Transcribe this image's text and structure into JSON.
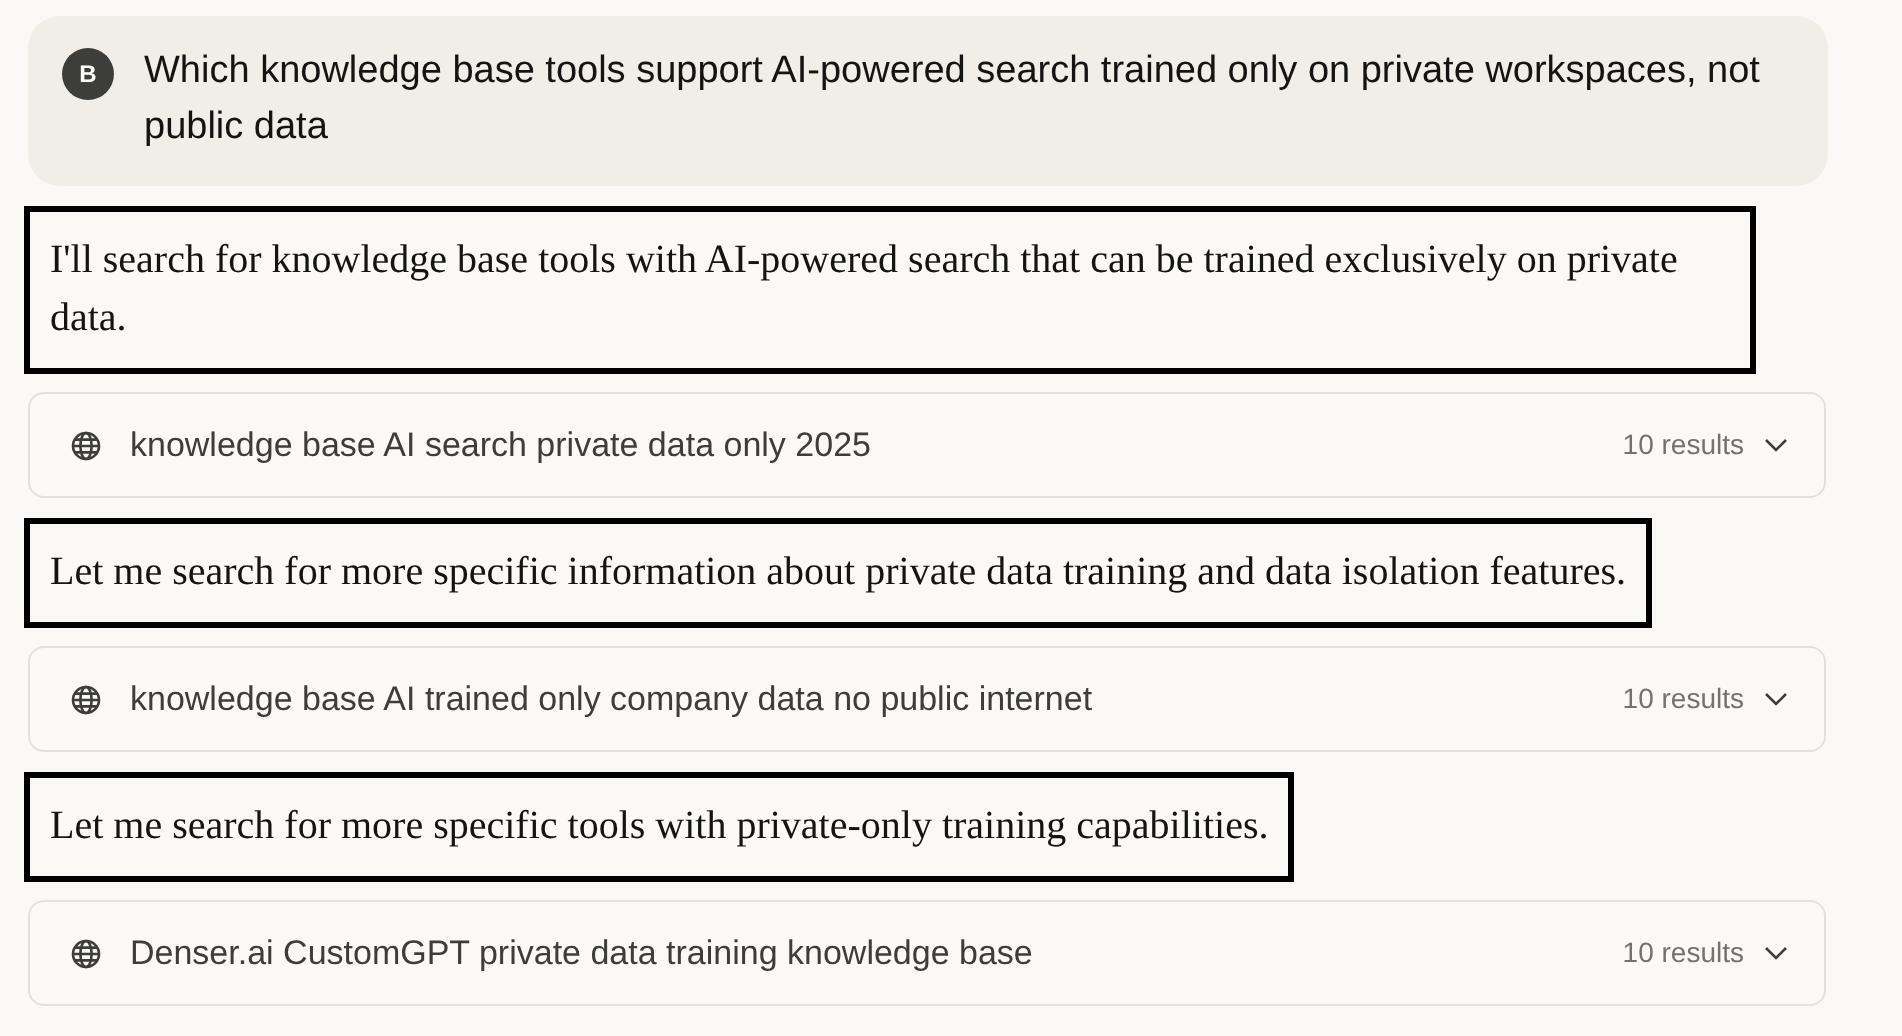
{
  "user_message": {
    "avatar": "B",
    "text": "Which knowledge base tools support AI-powered search trained only on private workspaces, not public data"
  },
  "items": [
    {
      "kind": "message",
      "boxed": true,
      "text": "I'll search for knowledge base tools with AI-powered search that can be trained exclusively on private data."
    },
    {
      "kind": "search",
      "query": "knowledge base AI search private data only 2025",
      "results": "10 results",
      "expanded": false
    },
    {
      "kind": "message",
      "boxed": true,
      "text": "Let me search for more specific information about private data training and data isolation features."
    },
    {
      "kind": "search",
      "query": "knowledge base AI trained only company data no public internet",
      "results": "10 results",
      "expanded": false
    },
    {
      "kind": "message",
      "boxed": true,
      "text": "Let me search for more specific tools with private-only training capabilities."
    },
    {
      "kind": "search",
      "query": "Denser.ai CustomGPT private data training knowledge base",
      "results": "10 results",
      "expanded": false
    }
  ]
}
